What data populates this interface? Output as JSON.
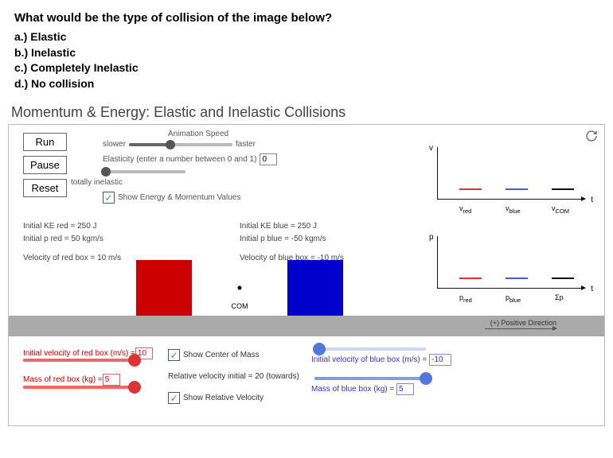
{
  "question": {
    "prompt": "What would be the type of collision of the image below?",
    "a": "a.) Elastic",
    "b": "b.) Inelastic",
    "c": "c.) Completely Inelastic",
    "d": "d.) No collision"
  },
  "sim_title": "Momentum & Energy: Elastic and Inelastic Collisions",
  "buttons": {
    "run": "Run",
    "pause": "Pause",
    "reset": "Reset"
  },
  "animation": {
    "heading": "Animation Speed",
    "slower": "slower",
    "faster": "faster"
  },
  "elasticity": {
    "label": "Elasticity (enter a number between 0 and 1)",
    "value": "0",
    "totally_label": "totally inelastic"
  },
  "show_energy_label": "Show Energy & Momentum Values",
  "red": {
    "ke": "Initial KE red = 250 J",
    "p": "Initial p red = 50 kgm/s",
    "v": "Velocity of red box = 10 m/s",
    "iv_label": "Initial velocity of red box (m/s) =",
    "iv_value": "10",
    "mass_label": "Mass of red box (kg) =",
    "mass_value": "5"
  },
  "blue": {
    "ke": "Initial KE blue = 250 J",
    "p": "Initial p blue = -50 kgm/s",
    "v": "Velocity of blue box = -10 m/s",
    "iv_label": "Initial velocity of blue box (m/s) =",
    "iv_value": "-10",
    "mass_label": "Mass of blue box (kg) =",
    "mass_value": "5"
  },
  "com_label": "COM",
  "positive_dir": "(+) Positive Direction",
  "checks": {
    "show_com": "Show Center of Mass",
    "rel_vel_initial": "Relative velocity initial = 20 (towards)",
    "show_rel_vel": "Show Relative Velocity"
  },
  "graph1": {
    "y": "v",
    "x": "t",
    "a": "v",
    "a_sub": "red",
    "b": "v",
    "b_sub": "blue",
    "c": "v",
    "c_sub": "COM"
  },
  "graph2": {
    "y": "p",
    "x": "t",
    "a": "p",
    "a_sub": "red",
    "b": "p",
    "b_sub": "blue",
    "c": "Σp"
  }
}
